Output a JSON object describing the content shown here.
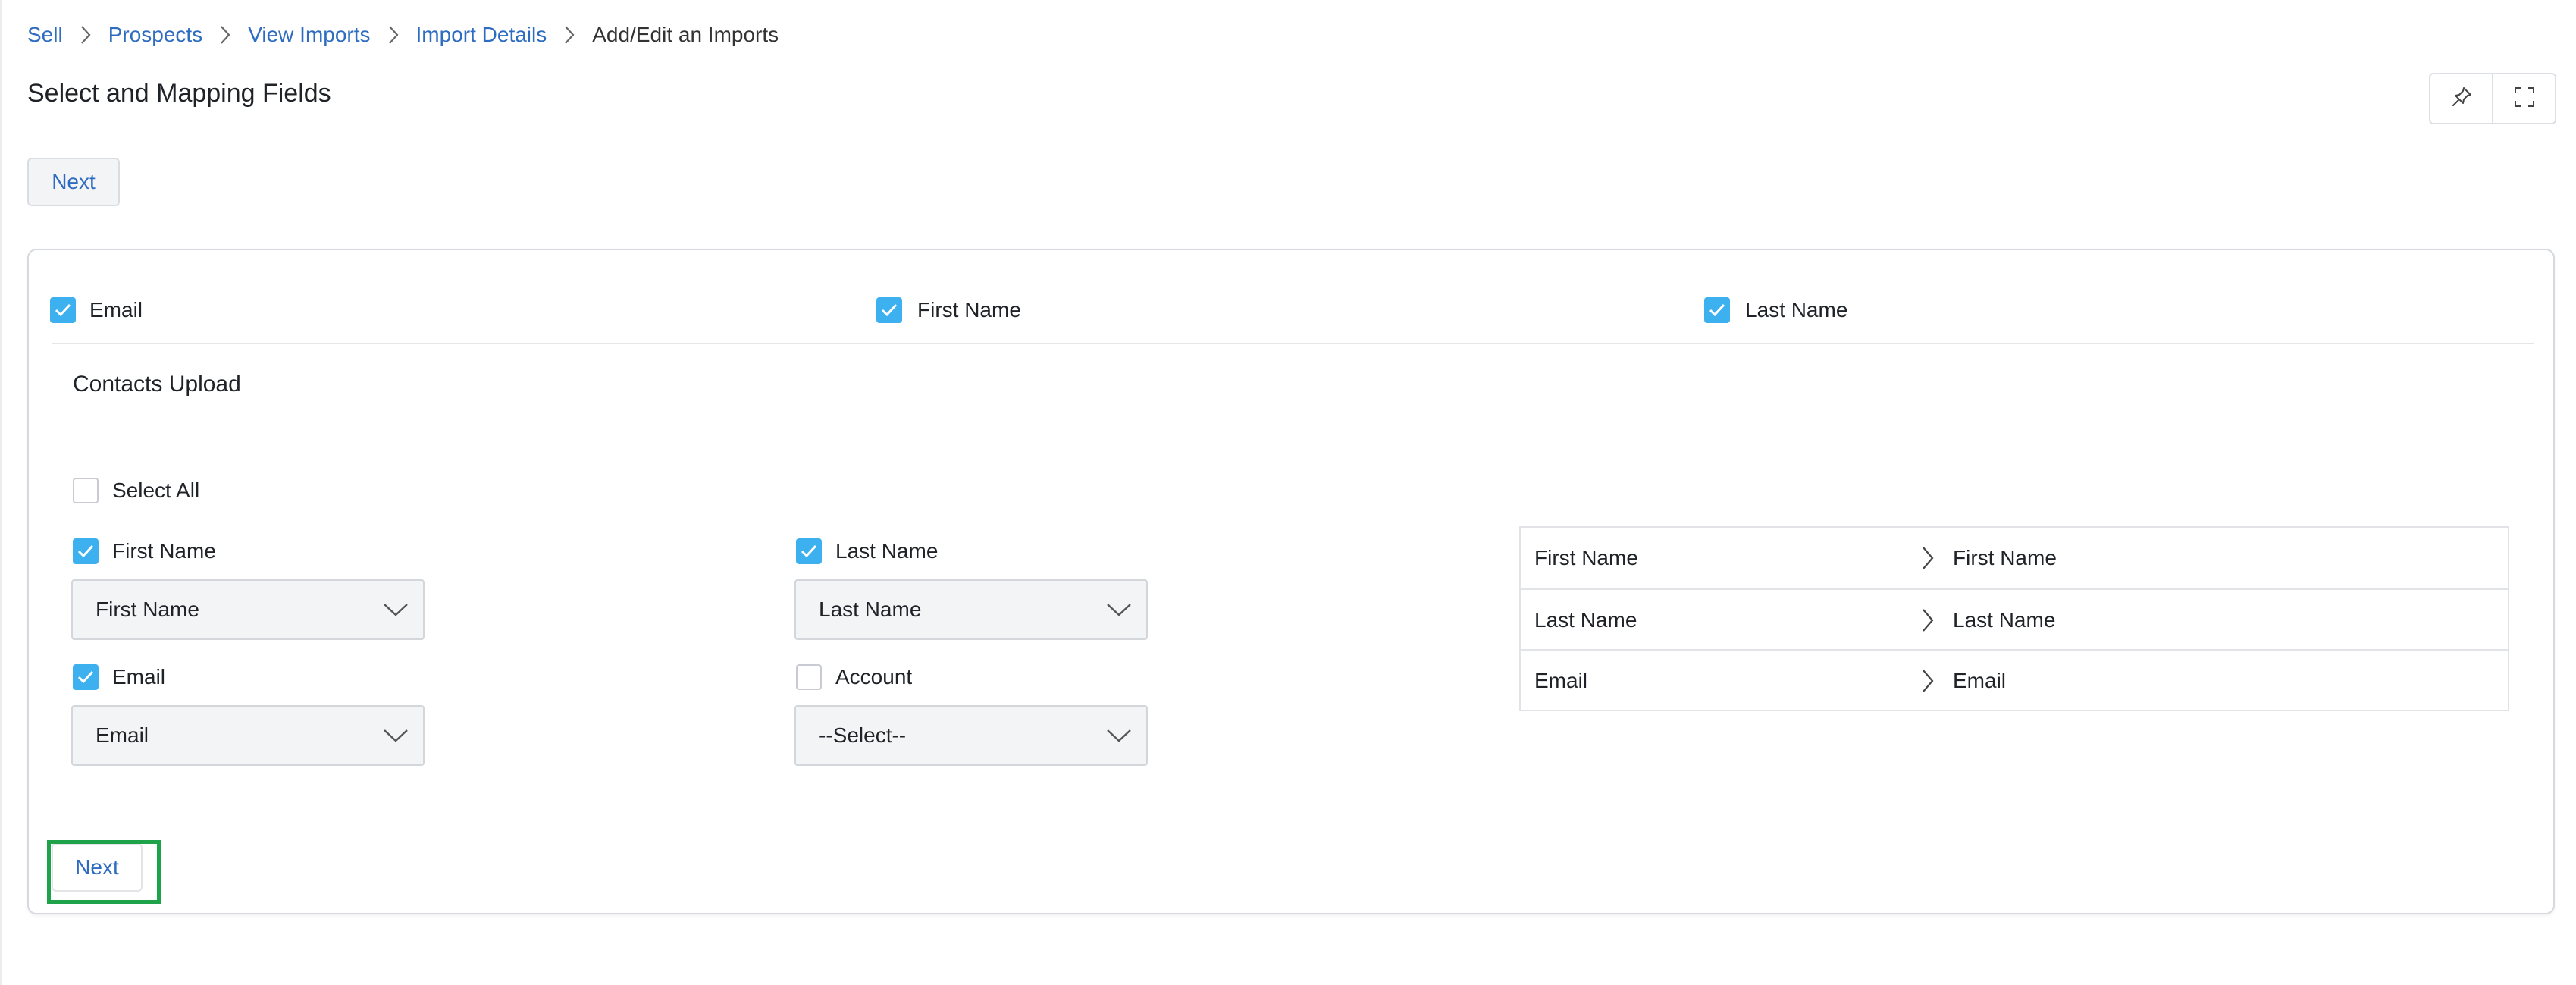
{
  "breadcrumb": {
    "items": [
      "Sell",
      "Prospects",
      "View Imports",
      "Import Details"
    ],
    "current": "Add/Edit an Imports"
  },
  "page": {
    "title": "Select and Mapping Fields"
  },
  "toolbar": {
    "pin_icon": "pin-icon",
    "expand_icon": "fullscreen-icon"
  },
  "actions": {
    "next_top_label": "Next",
    "next_bottom_label": "Next"
  },
  "column_filters": [
    {
      "label": "Email",
      "checked": true
    },
    {
      "label": "First Name",
      "checked": true
    },
    {
      "label": "Last Name",
      "checked": true
    }
  ],
  "section": {
    "title": "Contacts Upload",
    "select_all_label": "Select All",
    "select_all_checked": false
  },
  "fields": [
    {
      "label": "First Name",
      "checked": true,
      "mapped_value": "First Name"
    },
    {
      "label": "Last Name",
      "checked": true,
      "mapped_value": "Last Name"
    },
    {
      "label": "Email",
      "checked": true,
      "mapped_value": "Email"
    },
    {
      "label": "Account",
      "checked": false,
      "mapped_value": "--Select--"
    }
  ],
  "mapping": [
    {
      "source": "First Name",
      "target": "First Name"
    },
    {
      "source": "Last Name",
      "target": "Last Name"
    },
    {
      "source": "Email",
      "target": "Email"
    }
  ],
  "colors": {
    "link": "#2d6cc0",
    "checkbox_checked": "#3db0ef",
    "highlight": "#1fa34a"
  }
}
